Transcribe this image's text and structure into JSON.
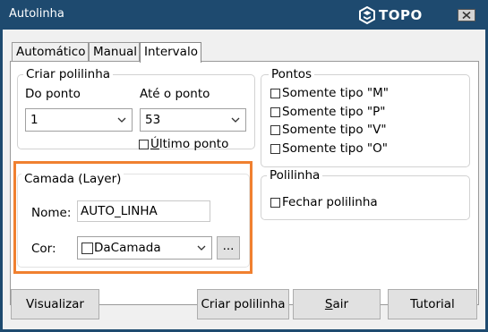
{
  "window": {
    "title": "Autolinha",
    "brand": "TOPO"
  },
  "tabs": [
    {
      "label": "Automático",
      "active": false
    },
    {
      "label": "Manual",
      "active": false
    },
    {
      "label": "Intervalo",
      "active": true
    }
  ],
  "criar_polilinha": {
    "legend": "Criar polilinha",
    "do_ponto_label": "Do ponto",
    "do_ponto_value": "1",
    "ate_ponto_label": "Até o ponto",
    "ate_ponto_value": "53",
    "ultimo_ponto": {
      "prefix": "Ú",
      "rest": "ltimo ponto",
      "checked": false
    }
  },
  "pontos": {
    "legend": "Pontos",
    "options": [
      {
        "label": "Somente tipo \"M\"",
        "checked": false
      },
      {
        "label": "Somente tipo \"P\"",
        "checked": false
      },
      {
        "label": "Somente tipo \"V\"",
        "checked": false
      },
      {
        "label": "Somente tipo \"O\"",
        "checked": false
      }
    ]
  },
  "camada": {
    "legend": "Camada (Layer)",
    "nome_label": "Nome:",
    "nome_value": "AUTO_LINHA",
    "cor_label": "Cor:",
    "cor_value": "DaCamada",
    "more_button": "..."
  },
  "polilinha": {
    "legend": "Polilinha",
    "fechar": {
      "label": "Fechar polilinha",
      "checked": false
    }
  },
  "buttons": {
    "visualizar": "Visualizar",
    "criar": "Criar polilinha",
    "sair_prefix": "S",
    "sair_rest": "air",
    "tutorial": "Tutorial"
  },
  "colors": {
    "title_bar": "#1e4a6f",
    "highlight": "#f08030"
  },
  "icons": [
    "topo-logo-icon",
    "close-icon",
    "chevron-down-icon"
  ]
}
